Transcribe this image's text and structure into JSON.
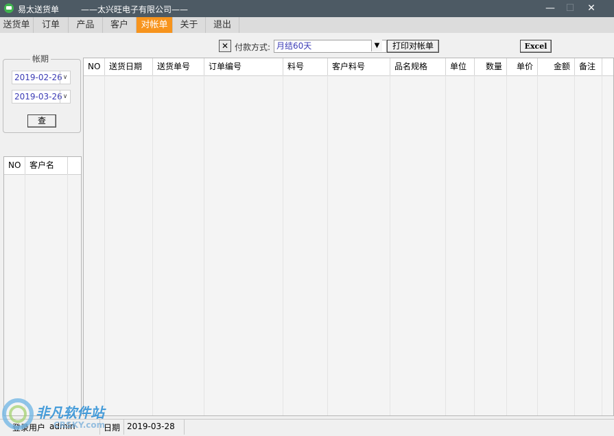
{
  "window": {
    "title": "易太送货单",
    "company": "——太兴旺电子有限公司——",
    "min": "—",
    "max": "☐",
    "close": "✕"
  },
  "tabs": [
    {
      "label": "送货单"
    },
    {
      "label": "订单"
    },
    {
      "label": "产品"
    },
    {
      "label": "客户"
    },
    {
      "label": "对帐单",
      "active": true
    },
    {
      "label": "关于"
    },
    {
      "label": "退出"
    }
  ],
  "toolbar": {
    "clear_label": "✕",
    "payment_label": "付款方式:",
    "payment_value": "月结60天",
    "dropdown": "▼",
    "print_label": "打印对帐单",
    "excel_label": "Excel"
  },
  "period": {
    "legend": "帐期",
    "start_date": "2019-02-26",
    "end_date": "2019-03-26",
    "dropdown": "∨",
    "query_label": "查"
  },
  "customer_table": {
    "columns": [
      "NO",
      "客户名"
    ]
  },
  "statement_table": {
    "columns": [
      "NO",
      "送货日期",
      "送货单号",
      "订单编号",
      "料号",
      "客户料号",
      "品名规格",
      "单位",
      "数量",
      "单价",
      "金额",
      "备注"
    ]
  },
  "status": {
    "user_label": "登录用户",
    "user_value": "admin",
    "date_label": "日期",
    "date_value": "2019-03-28"
  },
  "watermark": {
    "text": "非凡软件站",
    "sub": "CRSKY.com"
  },
  "colors": {
    "titlebar": "#4d5a64",
    "active_tab": "#f7941d",
    "date_text": "#3a3ab5"
  }
}
